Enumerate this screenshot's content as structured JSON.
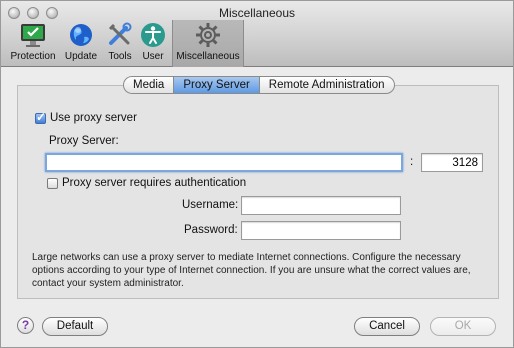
{
  "window": {
    "title": "Miscellaneous"
  },
  "toolbar": {
    "items": [
      {
        "label": "Protection",
        "icon": "monitor-check-icon"
      },
      {
        "label": "Update",
        "icon": "globe-icon"
      },
      {
        "label": "Tools",
        "icon": "tools-icon"
      },
      {
        "label": "User",
        "icon": "user-accessibility-icon"
      },
      {
        "label": "Miscellaneous",
        "icon": "gear-icon"
      }
    ],
    "selected": "Miscellaneous"
  },
  "tabs": [
    {
      "label": "Media"
    },
    {
      "label": "Proxy Server"
    },
    {
      "label": "Remote Administration"
    }
  ],
  "active_tab": "Proxy Server",
  "proxy": {
    "use_proxy_label": "Use proxy server",
    "use_proxy_checked": true,
    "server_label": "Proxy Server:",
    "server_value": "",
    "port_separator": ":",
    "port_value": "3128",
    "auth_label": "Proxy server requires authentication",
    "auth_checked": false,
    "username_label": "Username:",
    "username_value": "",
    "password_label": "Password:",
    "password_value": "",
    "info_text": "Large networks can use a proxy server to mediate Internet connections. Configure the necessary options according to your type of Internet connection. If you are unsure what the correct values are, contact your system administrator."
  },
  "buttons": {
    "help": "?",
    "default": "Default",
    "cancel": "Cancel",
    "ok": "OK"
  },
  "colors": {
    "accent": "#5f9ae3",
    "window_bg": "#ececec"
  }
}
